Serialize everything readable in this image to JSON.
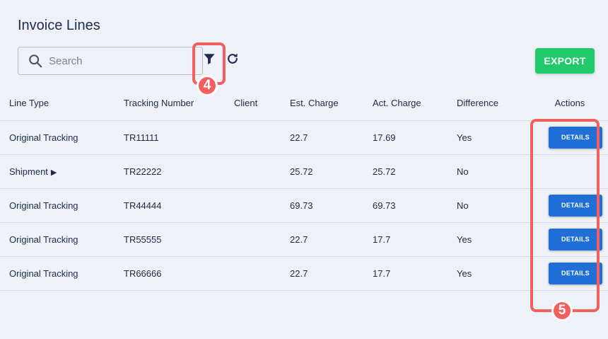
{
  "page": {
    "title": "Invoice Lines"
  },
  "toolbar": {
    "search_placeholder": "Search",
    "search_value": "",
    "filter_icon": "filter-icon",
    "refresh_icon": "refresh-icon",
    "export_label": "EXPORT",
    "export_color": "#22c96b"
  },
  "table": {
    "headers": [
      "Line Type",
      "Tracking Number",
      "Client",
      "Est. Charge",
      "Act. Charge",
      "Difference",
      "Actions"
    ],
    "rows": [
      {
        "line_type": "Original Tracking",
        "expandable": false,
        "tracking": "TR11111",
        "client": "",
        "est": "22.7",
        "act": "17.69",
        "diff": "Yes",
        "action": "DETAILS"
      },
      {
        "line_type": "Shipment",
        "expandable": true,
        "tracking": "TR22222",
        "client": "",
        "est": "25.72",
        "act": "25.72",
        "diff": "No",
        "action": ""
      },
      {
        "line_type": "Original Tracking",
        "expandable": false,
        "tracking": "TR44444",
        "client": "",
        "est": "69.73",
        "act": "69.73",
        "diff": "No",
        "action": "DETAILS"
      },
      {
        "line_type": "Original Tracking",
        "expandable": false,
        "tracking": "TR55555",
        "client": "",
        "est": "22.7",
        "act": "17.7",
        "diff": "Yes",
        "action": "DETAILS"
      },
      {
        "line_type": "Original Tracking",
        "expandable": false,
        "tracking": "TR66666",
        "client": "",
        "est": "22.7",
        "act": "17.7",
        "diff": "Yes",
        "action": "DETAILS"
      }
    ],
    "expand_glyph": "▶",
    "details_color": "#1f6fd6"
  },
  "annotations": [
    {
      "label": "4",
      "target": "filter-button",
      "color": "#f25f5f"
    },
    {
      "label": "5",
      "target": "actions-column",
      "color": "#f25f5f"
    }
  ]
}
